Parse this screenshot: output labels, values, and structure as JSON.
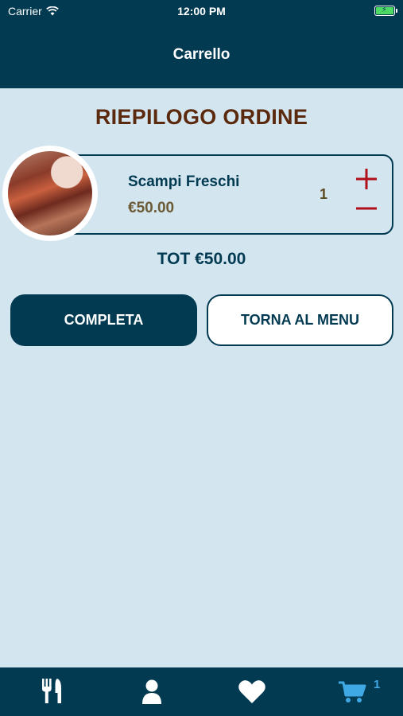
{
  "status_bar": {
    "carrier": "Carrier",
    "time": "12:00 PM"
  },
  "nav": {
    "title": "Carrello"
  },
  "summary": {
    "title": "RIEPILOGO ORDINE"
  },
  "cart_item": {
    "name": "Scampi Freschi",
    "price": "€50.00",
    "quantity": "1"
  },
  "total": "TOT €50.00",
  "buttons": {
    "complete": "COMPLETA",
    "back_to_menu": "TORNA AL MENU"
  },
  "tabbar": {
    "cart_badge": "1",
    "active_tab": "cart",
    "active_color": "#3fa9e6"
  },
  "colors": {
    "primary": "#023a52",
    "background": "#d3e6f0",
    "title_brown": "#5b2a0e",
    "accent_red": "#b0101a"
  }
}
